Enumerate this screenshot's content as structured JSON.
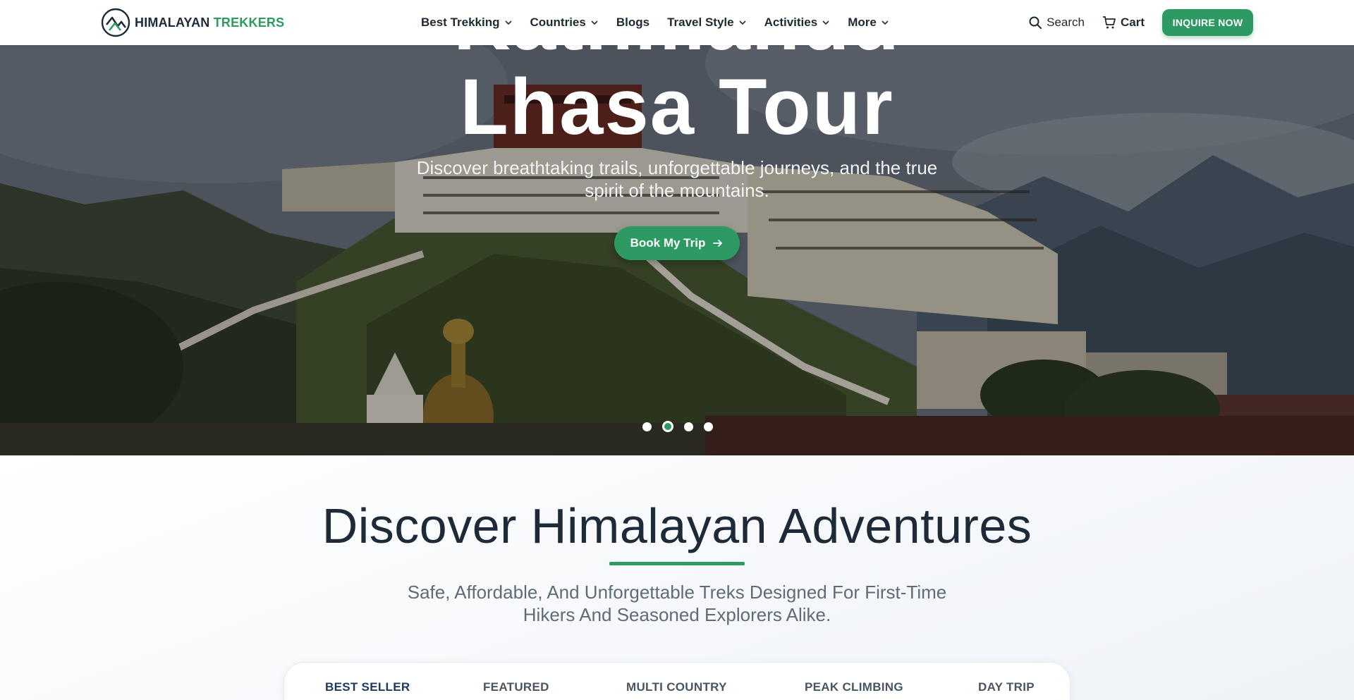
{
  "brand": {
    "word1": "HIMALAYAN",
    "word2": "TREKKERS",
    "accent": "#2e9a63",
    "dark": "#1e2a38"
  },
  "nav": [
    {
      "label": "Best Trekking",
      "dropdown": true
    },
    {
      "label": "Countries",
      "dropdown": true
    },
    {
      "label": "Blogs",
      "dropdown": false
    },
    {
      "label": "Travel Style",
      "dropdown": true
    },
    {
      "label": "Activities",
      "dropdown": true
    },
    {
      "label": "More",
      "dropdown": true
    }
  ],
  "header": {
    "search_label": "Search",
    "cart_label": "Cart",
    "inquire_label": "INQUIRE NOW"
  },
  "hero": {
    "title_line1": "Kathmandu",
    "title_line2": "Lhasa Tour",
    "subtitle": "Discover breathtaking trails, unforgettable journeys, and the true spirit of the mountains.",
    "button_label": "Book My Trip",
    "slides_count": 4,
    "active_slide": 2
  },
  "discover": {
    "title": "Discover Himalayan Adventures",
    "subtitle": "Safe, Affordable, And Unforgettable Treks Designed For First-Time Hikers And Seasoned Explorers Alike."
  },
  "tabs": [
    {
      "label": "BEST SELLER",
      "active": true
    },
    {
      "label": "FEATURED",
      "active": false
    },
    {
      "label": "MULTI COUNTRY",
      "active": false
    },
    {
      "label": "PEAK CLIMBING",
      "active": false
    },
    {
      "label": "DAY TRIP",
      "active": false
    }
  ]
}
